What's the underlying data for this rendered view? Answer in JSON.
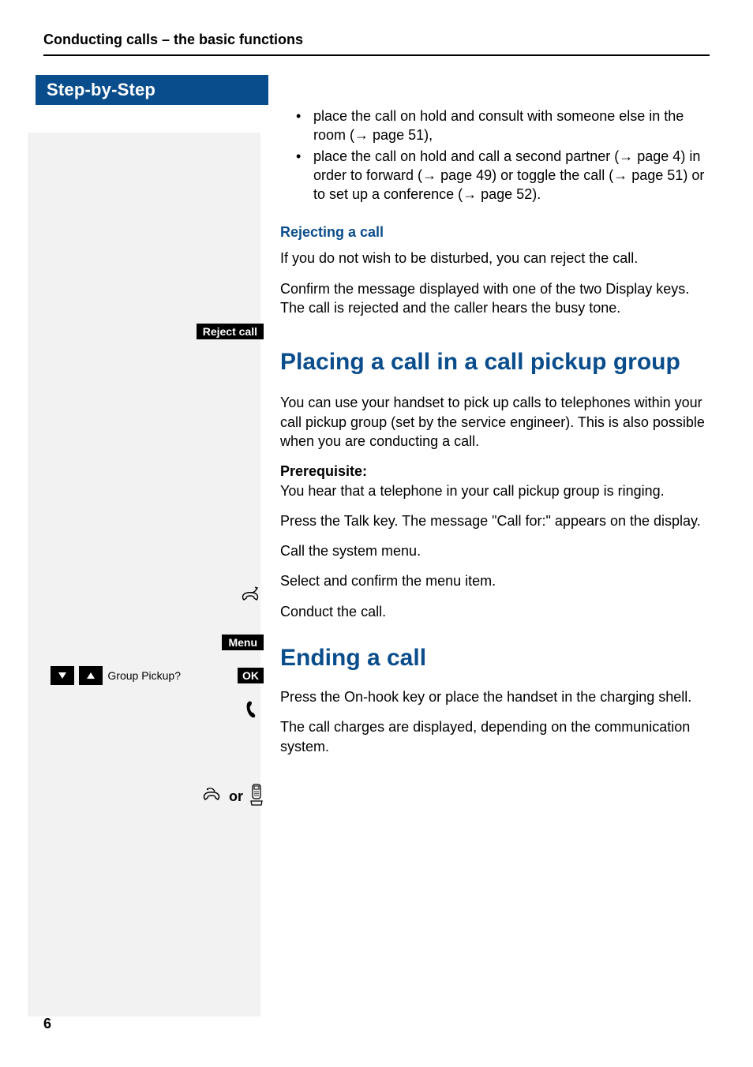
{
  "header": "Conducting calls – the basic functions",
  "sidebar": {
    "title": "Step-by-Step",
    "reject_pill": "Reject call",
    "menu_pill": "Menu",
    "group_pickup_text": "Group Pickup?",
    "ok_pill": "OK",
    "or_text": "or"
  },
  "content": {
    "bullets": [
      {
        "pre": "place the call on hold and consult with someone else in the room (",
        "ref1": "page 51",
        "post": "),"
      },
      {
        "pre": "place the call on hold and call a second partner (",
        "ref1": "page 4",
        "mid1": ") in order to forward (",
        "ref2": "page 49",
        "mid2": ") or toggle the call (",
        "ref3": "page 51",
        "mid3": ") or to set up a conference (",
        "ref4": "page 52",
        "post": ")."
      }
    ],
    "rejecting_heading": "Rejecting a call",
    "rejecting_p1": "If you do not wish to be disturbed, you can reject the call.",
    "rejecting_p2": "Confirm the message displayed with one of the two Display keys. The call is rejected and the caller hears the busy tone.",
    "placing_heading": "Placing a call in a call pickup group",
    "placing_p1": "You can use your handset to pick up calls to telephones within your call pickup group (set by the service engineer). This is also possible when you are conducting a call.",
    "prereq_label": "Prerequisite:",
    "prereq_text": "You hear that a telephone in your call pickup group is ringing.",
    "press_talk": "Press the Talk key. The message \"Call for:\" appears on the display.",
    "call_menu": "Call the system menu.",
    "select_confirm": "Select and confirm the menu item.",
    "conduct": "Conduct the call.",
    "ending_heading": "Ending a call",
    "ending_p1": "Press the On-hook key or place the handset in the charging shell.",
    "ending_p2": "The call charges are displayed, depending on the communication system."
  },
  "page_number": "6"
}
